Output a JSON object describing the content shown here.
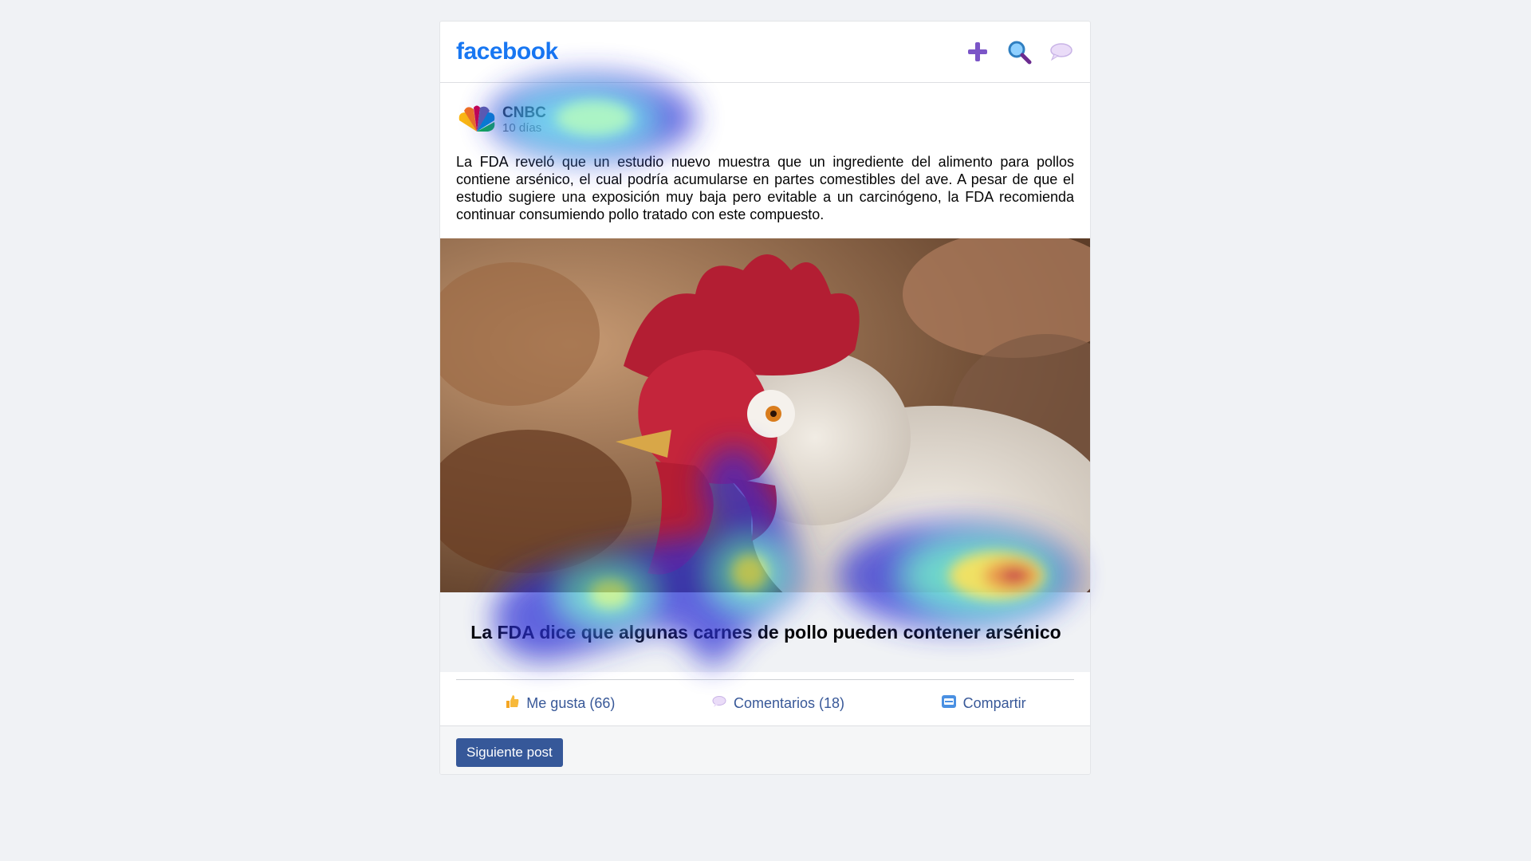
{
  "app": {
    "logo_text": "facebook",
    "brand_color": "#1877f2"
  },
  "topbar": {
    "icons": [
      "plus-icon",
      "search-icon",
      "chat-bubble-icon"
    ]
  },
  "post": {
    "source_name": "CNBC",
    "time": "10 días",
    "body": "La FDA reveló que un estudio nuevo muestra que un ingrediente del alimento para pollos contiene arsénico, el cual podría acumularse en partes comestibles del ave. A pesar de que el estudio sugiere una exposición muy baja pero evitable a un carcinógeno, la FDA recomienda continuar consumiendo pollo tratado con este compuesto.",
    "image_subject": "rooster-photo",
    "headline": "La FDA dice que algunas carnes de pollo pueden contener arsénico"
  },
  "actions": {
    "like_label": "Me gusta (66)",
    "comments_label": "Comentarios (18)",
    "share_label": "Compartir"
  },
  "footer": {
    "next_label": "Siguiente post"
  },
  "colors": {
    "link": "#385898",
    "button": "#365899",
    "headline_bg": "#f0f2f5"
  }
}
